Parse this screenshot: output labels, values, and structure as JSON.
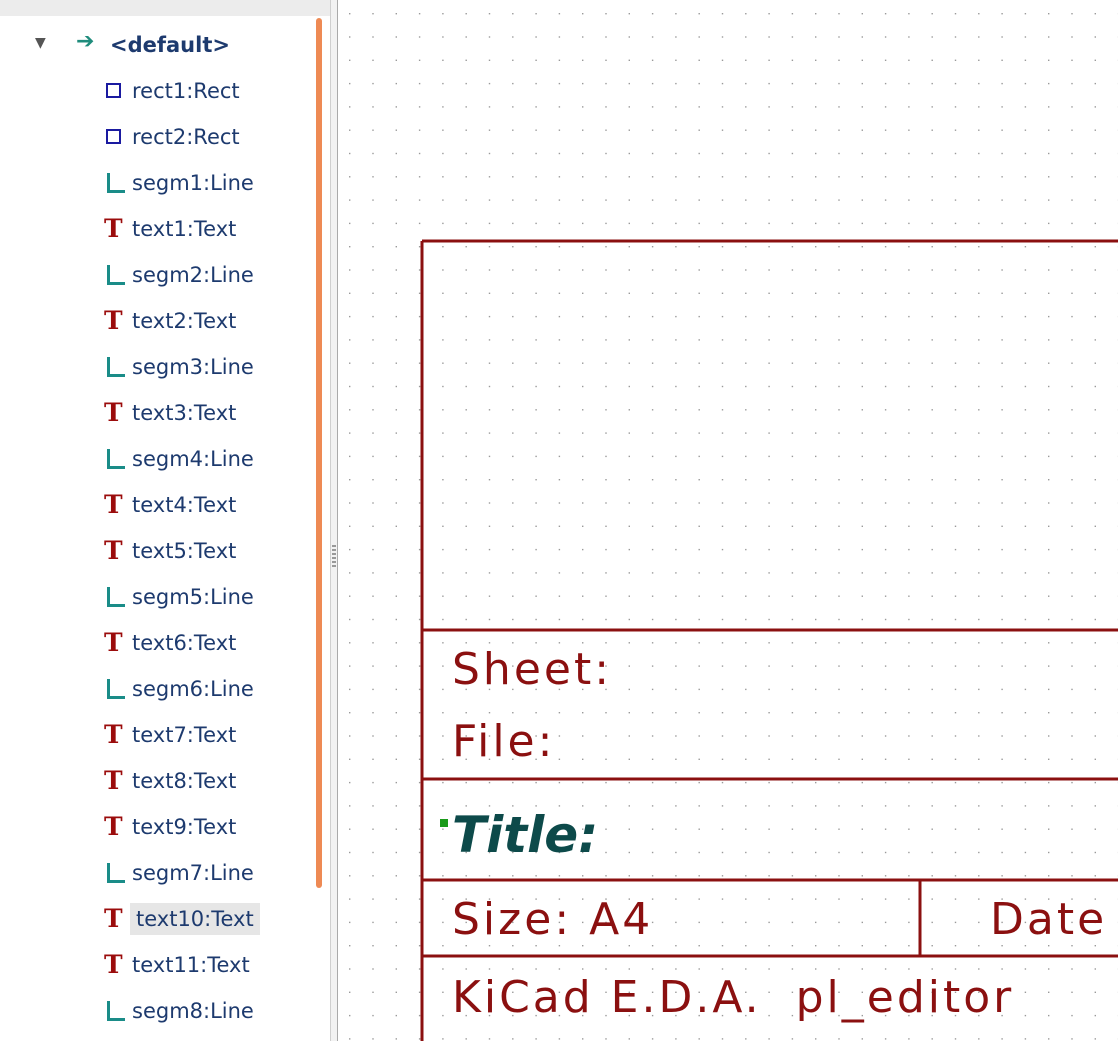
{
  "tree": {
    "root": {
      "label": "<default>",
      "expander": "▼",
      "icon": "arrow-right-icon"
    },
    "items": [
      {
        "label": "rect1:Rect",
        "type": "rect"
      },
      {
        "label": "rect2:Rect",
        "type": "rect"
      },
      {
        "label": "segm1:Line",
        "type": "line"
      },
      {
        "label": "text1:Text",
        "type": "text"
      },
      {
        "label": "segm2:Line",
        "type": "line"
      },
      {
        "label": "text2:Text",
        "type": "text"
      },
      {
        "label": "segm3:Line",
        "type": "line"
      },
      {
        "label": "text3:Text",
        "type": "text"
      },
      {
        "label": "segm4:Line",
        "type": "line"
      },
      {
        "label": "text4:Text",
        "type": "text"
      },
      {
        "label": "text5:Text",
        "type": "text"
      },
      {
        "label": "segm5:Line",
        "type": "line"
      },
      {
        "label": "text6:Text",
        "type": "text"
      },
      {
        "label": "segm6:Line",
        "type": "line"
      },
      {
        "label": "text7:Text",
        "type": "text"
      },
      {
        "label": "text8:Text",
        "type": "text"
      },
      {
        "label": "text9:Text",
        "type": "text"
      },
      {
        "label": "segm7:Line",
        "type": "line"
      },
      {
        "label": "text10:Text",
        "type": "text",
        "selected": true
      },
      {
        "label": "text11:Text",
        "type": "text"
      },
      {
        "label": "segm8:Line",
        "type": "line"
      }
    ]
  },
  "titleblock": {
    "sheet_label": "Sheet:",
    "file_label": "File:",
    "title_label": "Title:",
    "size_label": "Size: A4",
    "date_label": "Date",
    "kicad_label": "KiCad E.D.A.  pl_editor"
  },
  "colors": {
    "frame": "#8b1010",
    "grid_dot": "#9a9a9a",
    "title_text": "#0d4a4a",
    "anchor_marker": "#1a9a1a",
    "selection": "#e6e6e6"
  }
}
